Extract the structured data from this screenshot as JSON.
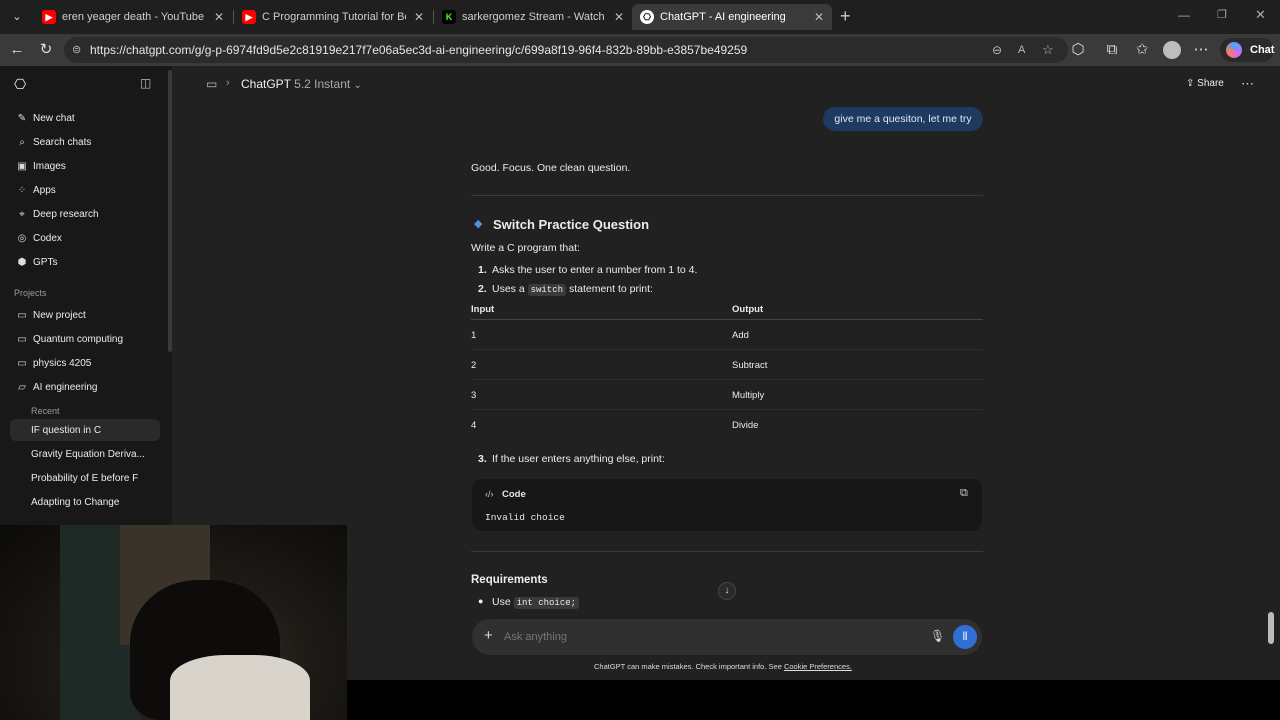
{
  "browser": {
    "tabs": [
      {
        "title": "eren yeager death - YouTube",
        "favicon": "youtube-icon",
        "color": "#ff0000",
        "active": false
      },
      {
        "title": "C Programming Tutorial for Beginn",
        "favicon": "youtube-icon",
        "color": "#ff0000",
        "active": false
      },
      {
        "title": "sarkergomez Stream - Watch Live",
        "favicon": "kick-icon",
        "color": "#53fc18",
        "active": false
      },
      {
        "title": "ChatGPT - AI engineering",
        "favicon": "chatgpt-icon",
        "color": "#ffffff",
        "active": true
      }
    ],
    "new_tab": "+",
    "url": "https://chatgpt.com/g/g-p-6974fd9d5e2c81919e217f7e06a5ec3d-ai-engineering/c/699a8f19-96f4-832b-89bb-e3857be49259",
    "chat_button": "Chat"
  },
  "sidebar": {
    "items": [
      {
        "label": "New chat",
        "icon": "edit-icon"
      },
      {
        "label": "Search chats",
        "icon": "search-icon"
      },
      {
        "label": "Images",
        "icon": "image-icon"
      },
      {
        "label": "Apps",
        "icon": "apps-icon"
      },
      {
        "label": "Deep research",
        "icon": "telescope-icon"
      },
      {
        "label": "Codex",
        "icon": "codex-icon"
      },
      {
        "label": "GPTs",
        "icon": "gpts-icon"
      }
    ],
    "projects_heading": "Projects",
    "projects": [
      {
        "label": "New project"
      },
      {
        "label": "Quantum computing"
      },
      {
        "label": "physics 4205"
      },
      {
        "label": "AI engineering"
      }
    ],
    "recent_heading": "Recent",
    "recent": [
      {
        "label": "IF question in C"
      },
      {
        "label": "Gravity Equation Deriva..."
      },
      {
        "label": "Probability of E before F"
      },
      {
        "label": "Adapting to Change"
      }
    ]
  },
  "header": {
    "model": "ChatGPT",
    "version": "5.2 Instant",
    "share": "Share"
  },
  "chat": {
    "user_message": "give me a quesiton, let me try",
    "intro": "Good. Focus. One clean question.",
    "heading": "Switch Practice Question",
    "lead": "Write a C program that:",
    "step1": "Asks the user to enter a number from 1 to 4.",
    "step2_pre": "Uses a",
    "step2_code": "switch",
    "step2_post": "statement to print:",
    "table": {
      "headers": [
        "Input",
        "Output"
      ],
      "rows": [
        [
          "1",
          "Add"
        ],
        [
          "2",
          "Subtract"
        ],
        [
          "3",
          "Multiply"
        ],
        [
          "4",
          "Divide"
        ]
      ]
    },
    "step3": "If the user enters anything else, print:",
    "code_label": "Code",
    "code_text": "Invalid choice",
    "requirements_heading": "Requirements",
    "req1_pre": "Use",
    "req1_code": "int choice;"
  },
  "composer": {
    "placeholder": "Ask anything",
    "disclaimer": "ChatGPT can make mistakes. Check important info. See",
    "disclaimer_link": "Cookie Preferences."
  }
}
